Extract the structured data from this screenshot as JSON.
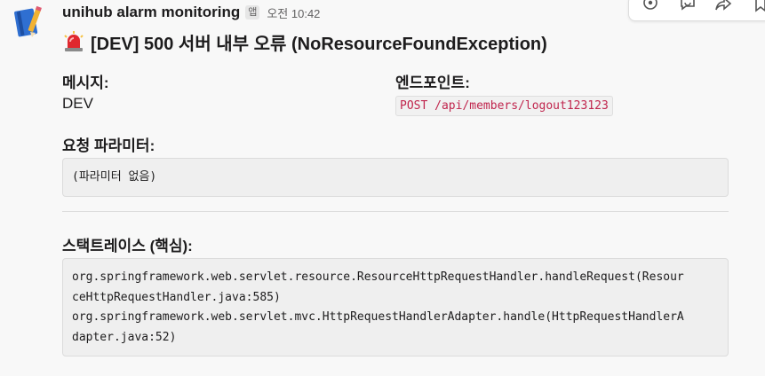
{
  "message": {
    "sender": "unihub alarm monitoring",
    "app_badge": "앱",
    "timestamp": "오전 10:42",
    "title": "[DEV] 500 서버 내부 오류 (NoResourceFoundException)",
    "title_icon": "rotating-light-icon"
  },
  "fields": {
    "message_label": "메시지:",
    "message_value": "DEV",
    "endpoint_label": "엔드포인트:",
    "endpoint_value": "POST /api/members/logout123123",
    "params_label": "요청 파라미터:",
    "params_value": "(파라미터 없음)",
    "stacktrace_label": "스택트레이스 (핵심):",
    "stacktrace_lines": [
      "org.springframework.web.servlet.resource.ResourceHttpRequestHandler.handleRequest(Resour",
      "ceHttpRequestHandler.java:585)",
      "org.springframework.web.servlet.mvc.HttpRequestHandlerAdapter.handle(HttpRequestHandlerA",
      "dapter.java:52)"
    ]
  },
  "hover_toolbar": {
    "icons": [
      "emoji-reaction-icon",
      "reply-in-thread-icon",
      "share-icon"
    ]
  }
}
